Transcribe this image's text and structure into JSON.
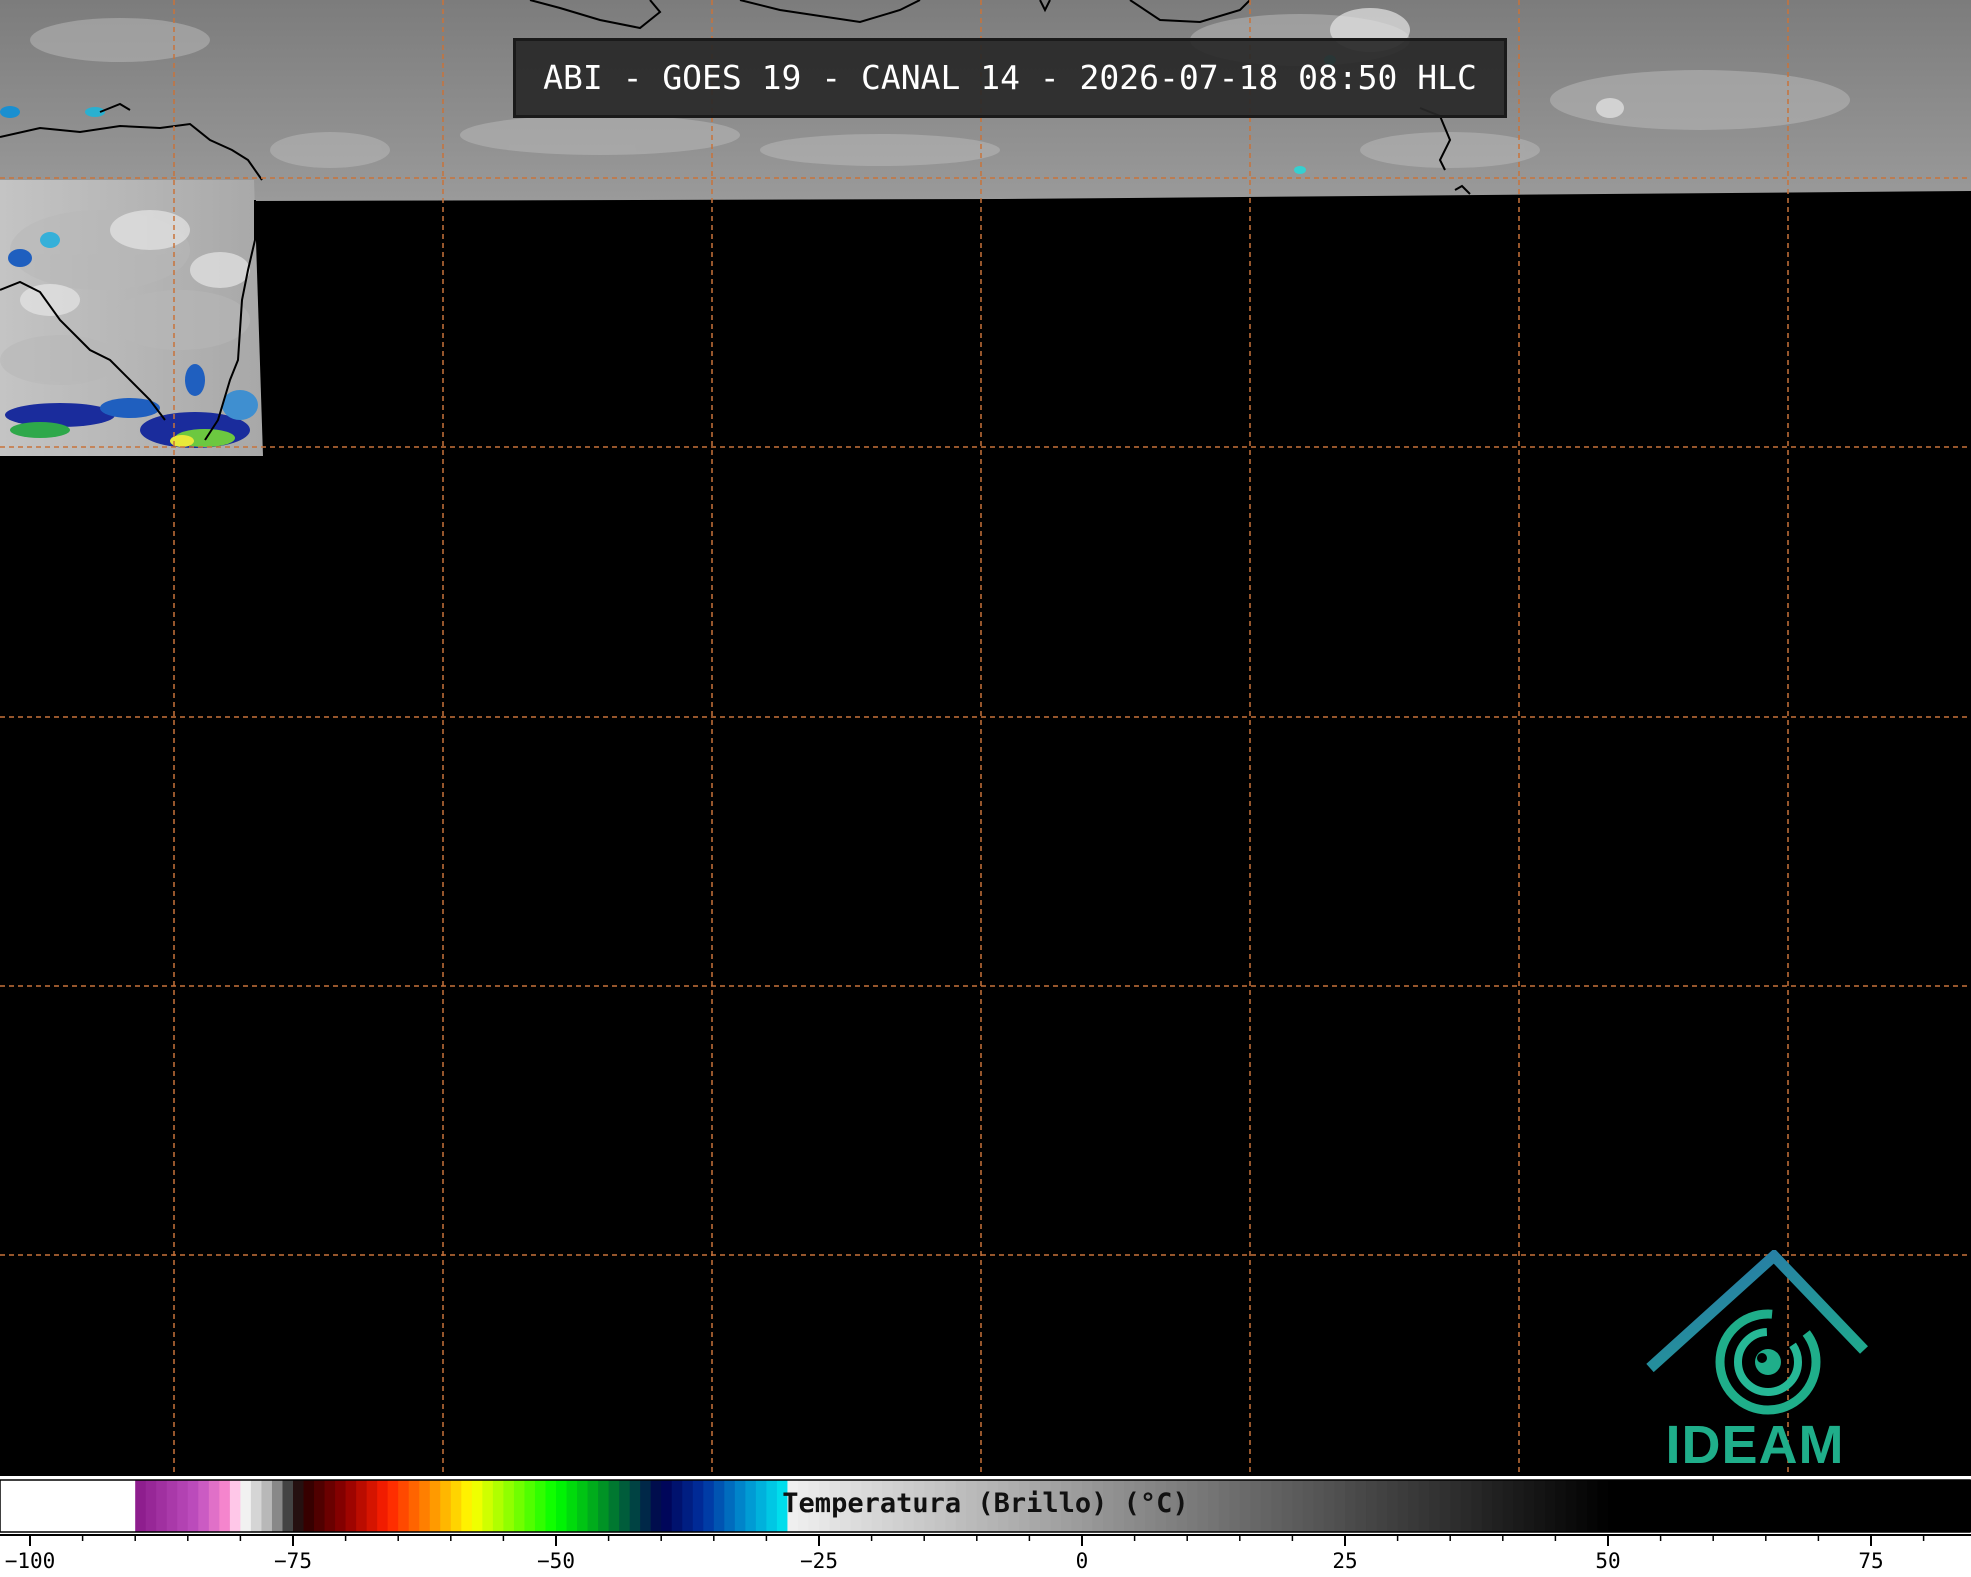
{
  "title": "ABI - GOES 19 - CANAL 14 - 2026-07-18 08:50 HLC",
  "logo": {
    "text": "IDEAM",
    "icon": "ideam-swirl-icon",
    "colors": {
      "teal": "#1fae8a",
      "blue": "#2a6fae"
    }
  },
  "colorbar": {
    "label": "Temperatura (Brillo) (°C)",
    "min": -100,
    "max": 85,
    "tick_labels": [
      "−100",
      "−75",
      "−50",
      "−25",
      "0",
      "25",
      "50",
      "75"
    ],
    "tick_values": [
      -100,
      -75,
      -50,
      -25,
      0,
      25,
      50,
      75
    ],
    "minor_tick_step": 5
  },
  "map": {
    "gridline_color": "#c8733a",
    "background_color": "#000000",
    "imagery": "infrared brightness temperature (partial coverage)"
  }
}
